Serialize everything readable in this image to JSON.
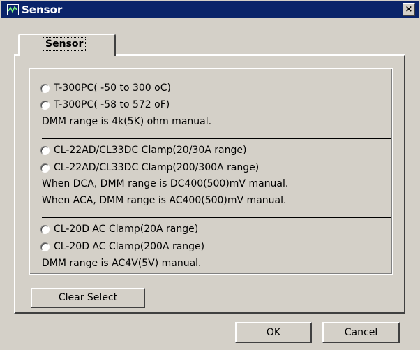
{
  "window": {
    "title": "Sensor",
    "close_glyph": "×"
  },
  "tab": {
    "label": "Sensor"
  },
  "options": [
    {
      "label": "T-300PC( -50 to 300 oC)"
    },
    {
      "label": "T-300PC( -58 to 572 oF)"
    },
    {
      "label": "CL-22AD/CL33DC Clamp(20/30A range)"
    },
    {
      "label": "CL-22AD/CL33DC Clamp(200/300A range)"
    },
    {
      "label": "CL-20D AC Clamp(20A range)"
    },
    {
      "label": "CL-20D AC Clamp(200A range)"
    }
  ],
  "notes": [
    "DMM range is 4k(5K) ohm manual.",
    "When DCA, DMM range is DC400(500)mV manual.",
    "When ACA, DMM range is AC400(500)mV manual.",
    "DMM range is AC4V(5V) manual."
  ],
  "buttons": {
    "clear_select": "Clear Select",
    "ok": "OK",
    "cancel": "Cancel"
  },
  "icons": {
    "app": "waveform-icon",
    "close": "close-icon"
  }
}
